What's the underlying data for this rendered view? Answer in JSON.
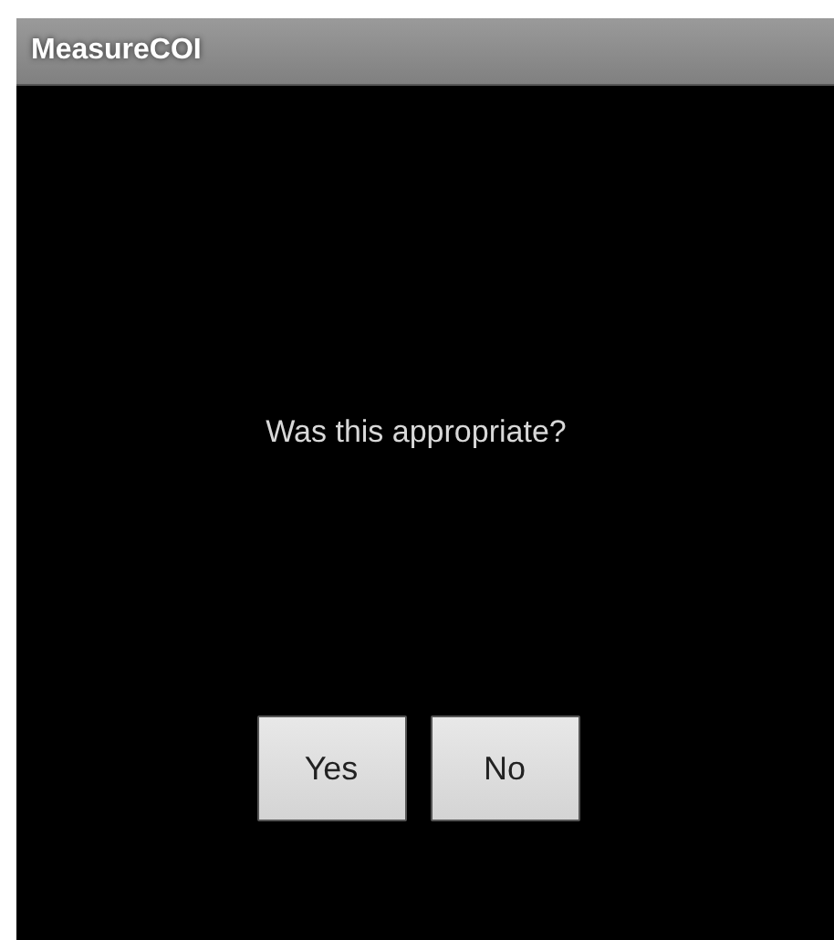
{
  "window": {
    "title": "MeasureCOI"
  },
  "question": "Was this appropriate?",
  "buttons": [
    {
      "label": "Yes"
    },
    {
      "label": "No"
    }
  ]
}
